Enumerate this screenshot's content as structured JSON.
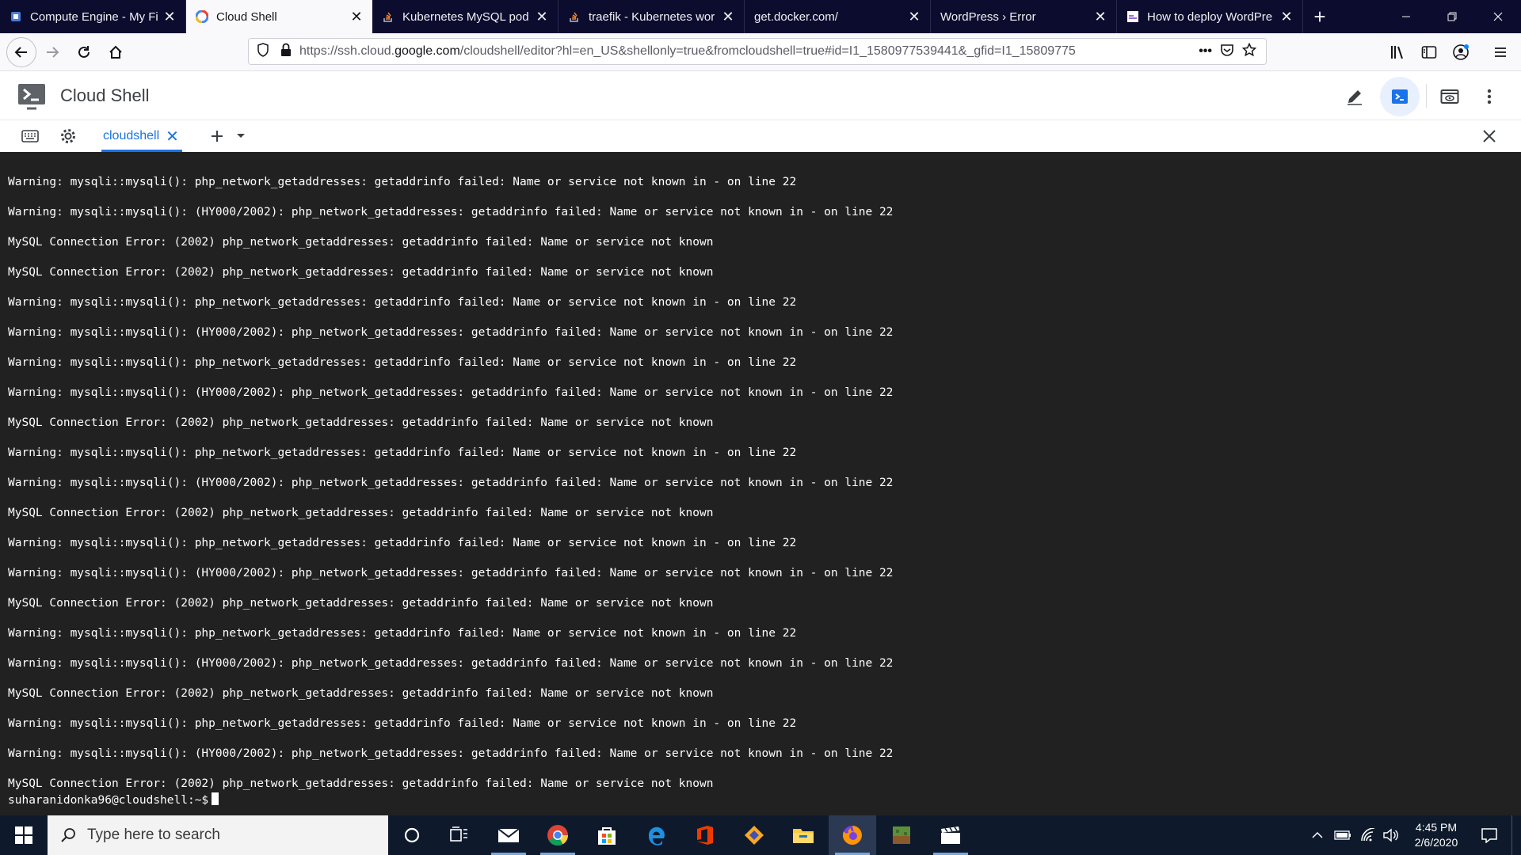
{
  "browser": {
    "tabs": [
      {
        "title": "Compute Engine - My Fi",
        "favicon": "compute-engine-icon"
      },
      {
        "title": "Cloud Shell",
        "favicon": "google-cloud-icon",
        "active": true
      },
      {
        "title": "Kubernetes MySQL pod",
        "favicon": "stackoverflow-icon"
      },
      {
        "title": "traefik - Kubernetes wor",
        "favicon": "stackoverflow-icon"
      },
      {
        "title": "get.docker.com/",
        "favicon": "none"
      },
      {
        "title": "WordPress › Error",
        "favicon": "none"
      },
      {
        "title": "How to deploy WordPre",
        "favicon": "site-icon"
      }
    ],
    "new_tab_label": "+",
    "url_prefix": "https://ssh.cloud.",
    "url_domain": "google.com",
    "url_rest": "/cloudshell/editor?hl=en_US&shellonly=true&fromcloudshell=true#id=I1_1580977539441&_gfid=I1_15809775",
    "url_menu": "•••"
  },
  "cloudshell": {
    "title": "Cloud Shell",
    "terminal_tab_label": "cloudshell"
  },
  "terminal": {
    "lines": [
      "Warning: mysqli::mysqli(): php_network_getaddresses: getaddrinfo failed: Name or service not known in - on line 22",
      "Warning: mysqli::mysqli(): (HY000/2002): php_network_getaddresses: getaddrinfo failed: Name or service not known in - on line 22",
      "MySQL Connection Error: (2002) php_network_getaddresses: getaddrinfo failed: Name or service not known",
      "MySQL Connection Error: (2002) php_network_getaddresses: getaddrinfo failed: Name or service not known",
      "Warning: mysqli::mysqli(): php_network_getaddresses: getaddrinfo failed: Name or service not known in - on line 22",
      "Warning: mysqli::mysqli(): (HY000/2002): php_network_getaddresses: getaddrinfo failed: Name or service not known in - on line 22",
      "Warning: mysqli::mysqli(): php_network_getaddresses: getaddrinfo failed: Name or service not known in - on line 22",
      "Warning: mysqli::mysqli(): (HY000/2002): php_network_getaddresses: getaddrinfo failed: Name or service not known in - on line 22",
      "MySQL Connection Error: (2002) php_network_getaddresses: getaddrinfo failed: Name or service not known",
      "Warning: mysqli::mysqli(): php_network_getaddresses: getaddrinfo failed: Name or service not known in - on line 22",
      "Warning: mysqli::mysqli(): (HY000/2002): php_network_getaddresses: getaddrinfo failed: Name or service not known in - on line 22",
      "MySQL Connection Error: (2002) php_network_getaddresses: getaddrinfo failed: Name or service not known",
      "Warning: mysqli::mysqli(): php_network_getaddresses: getaddrinfo failed: Name or service not known in - on line 22",
      "Warning: mysqli::mysqli(): (HY000/2002): php_network_getaddresses: getaddrinfo failed: Name or service not known in - on line 22",
      "MySQL Connection Error: (2002) php_network_getaddresses: getaddrinfo failed: Name or service not known",
      "Warning: mysqli::mysqli(): php_network_getaddresses: getaddrinfo failed: Name or service not known in - on line 22",
      "Warning: mysqli::mysqli(): (HY000/2002): php_network_getaddresses: getaddrinfo failed: Name or service not known in - on line 22",
      "MySQL Connection Error: (2002) php_network_getaddresses: getaddrinfo failed: Name or service not known",
      "Warning: mysqli::mysqli(): php_network_getaddresses: getaddrinfo failed: Name or service not known in - on line 22",
      "Warning: mysqli::mysqli(): (HY000/2002): php_network_getaddresses: getaddrinfo failed: Name or service not known in - on line 22",
      "MySQL Connection Error: (2002) php_network_getaddresses: getaddrinfo failed: Name or service not known"
    ],
    "prompt": "suharanidonka96@cloudshell:~$"
  },
  "taskbar": {
    "search_placeholder": "Type here to search",
    "time": "4:45 PM",
    "date": "2/6/2020"
  },
  "colors": {
    "tabbar_bg": "#0c0c2e",
    "terminal_bg": "#212121",
    "accent_blue": "#1a73e8",
    "taskbar_bg": "#0e1a2c"
  }
}
